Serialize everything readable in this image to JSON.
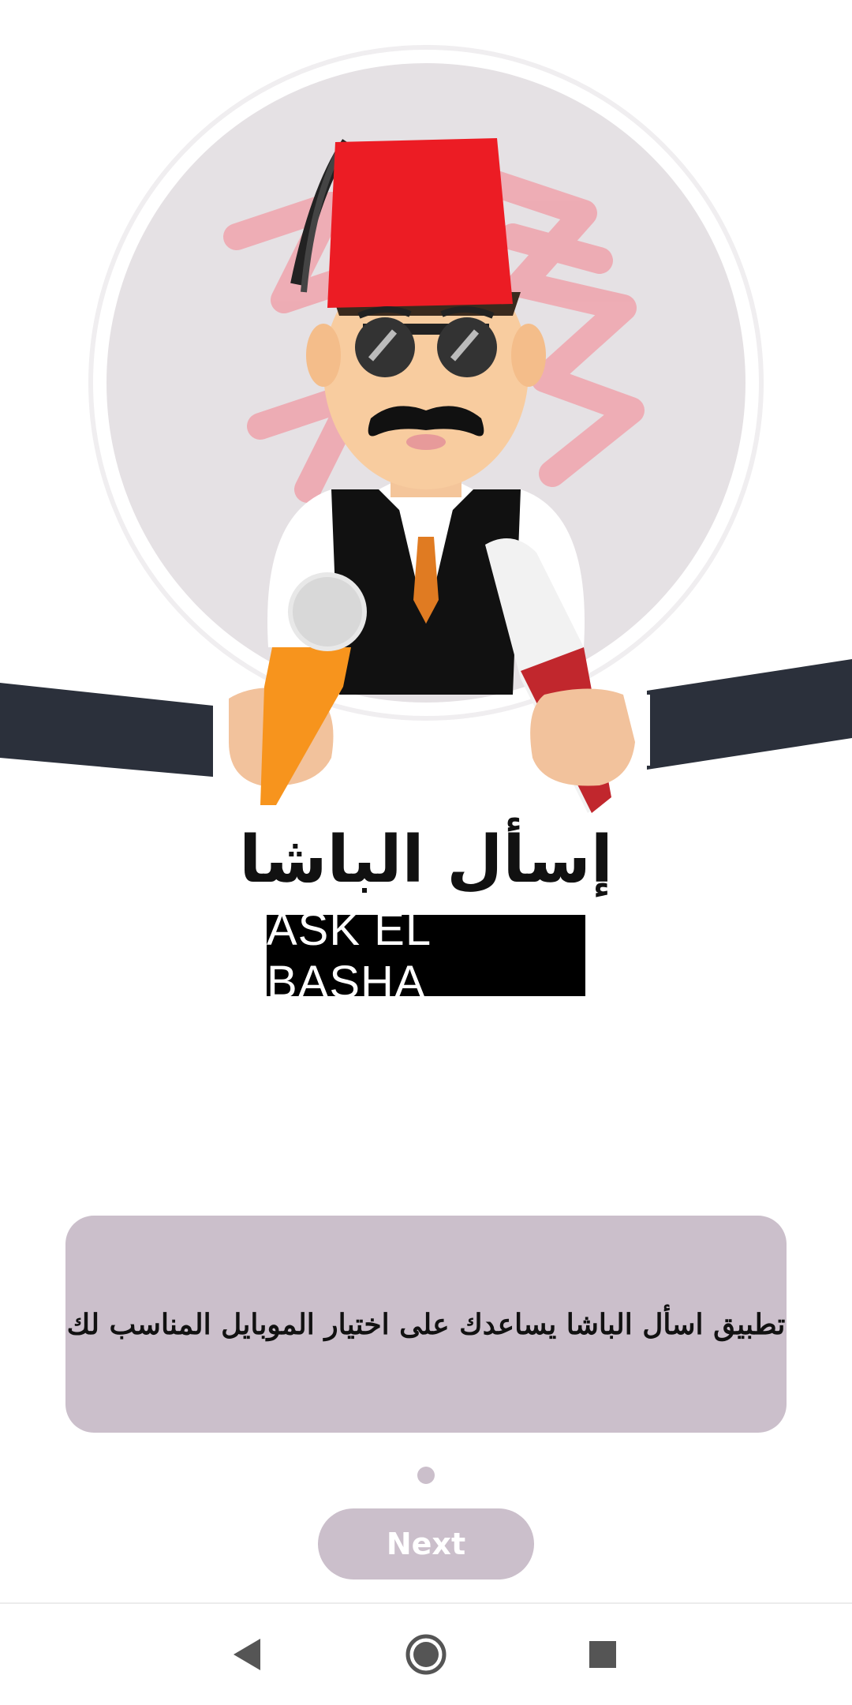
{
  "app": {
    "title_ar": "إسأل الباشا",
    "title_en": "ASK EL BASHA"
  },
  "intro": {
    "description": "تطبيق اسأل الباشا يساعدك على اختيار الموبايل المناسب لك"
  },
  "pager": {
    "active_index": 1,
    "count": 1
  },
  "actions": {
    "next_label": "Next"
  },
  "navbar": {
    "back_icon": "back-triangle",
    "home_icon": "home-circle",
    "recent_icon": "recent-square"
  },
  "colors": {
    "accent": "#cbbfcb",
    "fez": "#ec1c24",
    "mic_orange": "#f7941d",
    "mic_red": "#c1272d"
  }
}
